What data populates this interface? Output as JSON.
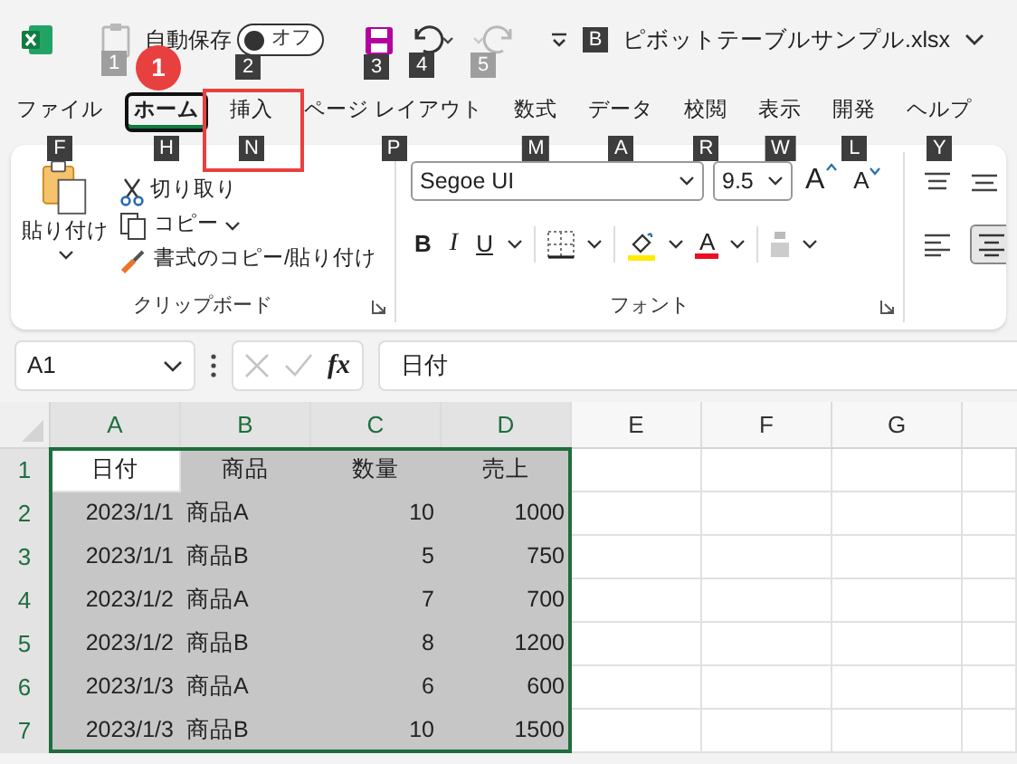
{
  "title_bar": {
    "quick_access": [
      {
        "kind": "clipboard",
        "keytip": "1",
        "disabled": true
      },
      {
        "kind": "autosave",
        "label": "自動保存",
        "toggle_text": "オフ",
        "on": false,
        "keytip": "2"
      },
      {
        "kind": "save",
        "keytip": "3",
        "disabled": false
      },
      {
        "kind": "undo",
        "keytip": "4",
        "disabled": false
      },
      {
        "kind": "redo",
        "keytip": "5",
        "disabled": true
      }
    ],
    "file": {
      "keytip": "B",
      "name": "ピボットテーブルサンプル.xlsx"
    }
  },
  "tabs": [
    {
      "label": "ファイル",
      "keytip": "F",
      "selected": false,
      "boxed": false
    },
    {
      "label": "ホーム",
      "keytip": "H",
      "selected": true,
      "boxed": false,
      "badge": "1"
    },
    {
      "label": "挿入",
      "keytip": "N",
      "selected": false,
      "boxed": true
    },
    {
      "label": "ページ レイアウト",
      "keytip": "P",
      "selected": false,
      "boxed": false
    },
    {
      "label": "数式",
      "keytip": "M",
      "selected": false,
      "boxed": false
    },
    {
      "label": "データ",
      "keytip": "A",
      "selected": false,
      "boxed": false
    },
    {
      "label": "校閲",
      "keytip": "R",
      "selected": false,
      "boxed": false
    },
    {
      "label": "表示",
      "keytip": "W",
      "selected": false,
      "boxed": false
    },
    {
      "label": "開発",
      "keytip": "L",
      "selected": false,
      "boxed": false
    },
    {
      "label": "ヘルプ",
      "keytip": "Y",
      "selected": false,
      "boxed": false
    }
  ],
  "ribbon": {
    "clipboard": {
      "paste": "貼り付け",
      "cut": "切り取り",
      "copy": "コピー",
      "format_painter": "書式のコピー/貼り付け",
      "label": "クリップボード"
    },
    "font": {
      "name": "Segoe UI",
      "size": "9.5",
      "grow": "A",
      "shrink": "A",
      "bold": "B",
      "italic": "I",
      "underline": "U",
      "font_color": "A",
      "label": "フォント"
    }
  },
  "formula_bar": {
    "name_box": "A1",
    "function_label": "fx",
    "content": "日付"
  },
  "grid": {
    "columns": [
      {
        "label": "A",
        "kind": "date",
        "selected": true
      },
      {
        "label": "B",
        "kind": "text",
        "selected": true
      },
      {
        "label": "C",
        "kind": "number",
        "selected": true
      },
      {
        "label": "D",
        "kind": "number",
        "selected": true
      },
      {
        "label": "E",
        "selected": false
      },
      {
        "label": "F",
        "selected": false
      },
      {
        "label": "G",
        "selected": false
      }
    ],
    "rows": [
      {
        "header": "1",
        "kind": "header",
        "selected": true,
        "cells": [
          {
            "text": "日付",
            "active": true
          },
          {
            "text": "商品",
            "active": false
          },
          {
            "text": "数量",
            "active": false
          },
          {
            "text": "売上",
            "active": false
          }
        ]
      },
      {
        "header": "2",
        "kind": "data",
        "selected": true,
        "cells": [
          {
            "text": "2023/1/1",
            "active": false
          },
          {
            "text": "商品A",
            "active": false
          },
          {
            "text": "10",
            "active": false
          },
          {
            "text": "1000",
            "active": false
          }
        ]
      },
      {
        "header": "3",
        "kind": "data",
        "selected": true,
        "cells": [
          {
            "text": "2023/1/1",
            "active": false
          },
          {
            "text": "商品B",
            "active": false
          },
          {
            "text": "5",
            "active": false
          },
          {
            "text": "750",
            "active": false
          }
        ]
      },
      {
        "header": "4",
        "kind": "data",
        "selected": true,
        "cells": [
          {
            "text": "2023/1/2",
            "active": false
          },
          {
            "text": "商品A",
            "active": false
          },
          {
            "text": "7",
            "active": false
          },
          {
            "text": "700",
            "active": false
          }
        ]
      },
      {
        "header": "5",
        "kind": "data",
        "selected": true,
        "cells": [
          {
            "text": "2023/1/2",
            "active": false
          },
          {
            "text": "商品B",
            "active": false
          },
          {
            "text": "8",
            "active": false
          },
          {
            "text": "1200",
            "active": false
          }
        ]
      },
      {
        "header": "6",
        "kind": "data",
        "selected": true,
        "cells": [
          {
            "text": "2023/1/3",
            "active": false
          },
          {
            "text": "商品A",
            "active": false
          },
          {
            "text": "6",
            "active": false
          },
          {
            "text": "600",
            "active": false
          }
        ]
      },
      {
        "header": "7",
        "kind": "data",
        "selected": true,
        "cells": [
          {
            "text": "2023/1/3",
            "active": false
          },
          {
            "text": "商品B",
            "active": false
          },
          {
            "text": "10",
            "active": false
          },
          {
            "text": "1500",
            "active": false
          }
        ]
      }
    ]
  }
}
